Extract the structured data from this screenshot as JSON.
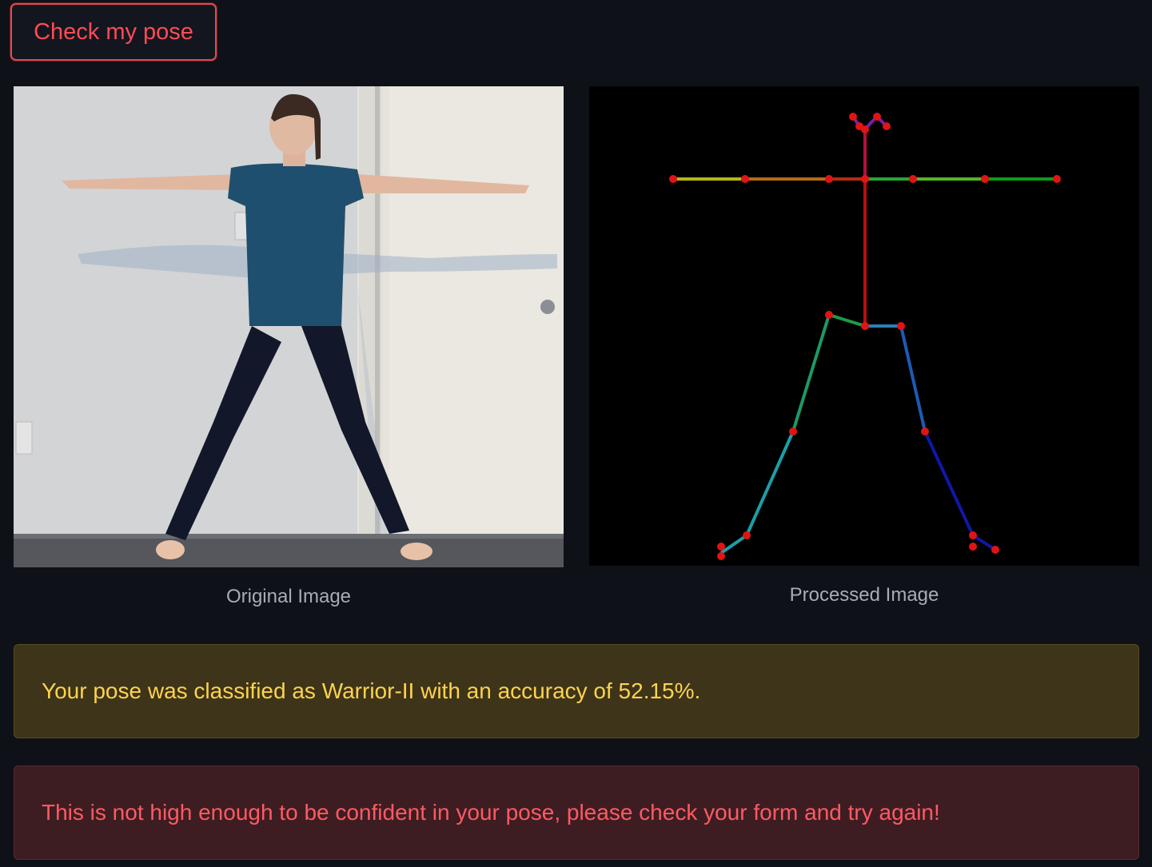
{
  "button": {
    "label": "Check my pose"
  },
  "images": {
    "original": {
      "caption": "Original Image"
    },
    "processed": {
      "caption": "Processed Image"
    }
  },
  "alerts": {
    "warning": "Your pose was classified as Warrior-II with an accuracy of 52.15%.",
    "error": "This is not high enough to be confident in your pose, please check your form and try again!"
  },
  "colors": {
    "background": "#0e1117",
    "accent_red": "#ff4b55",
    "warning_bg": "#3d3419",
    "warning_text": "#ffd34e",
    "error_bg": "#3d1d22",
    "error_text": "#ff5a63"
  }
}
